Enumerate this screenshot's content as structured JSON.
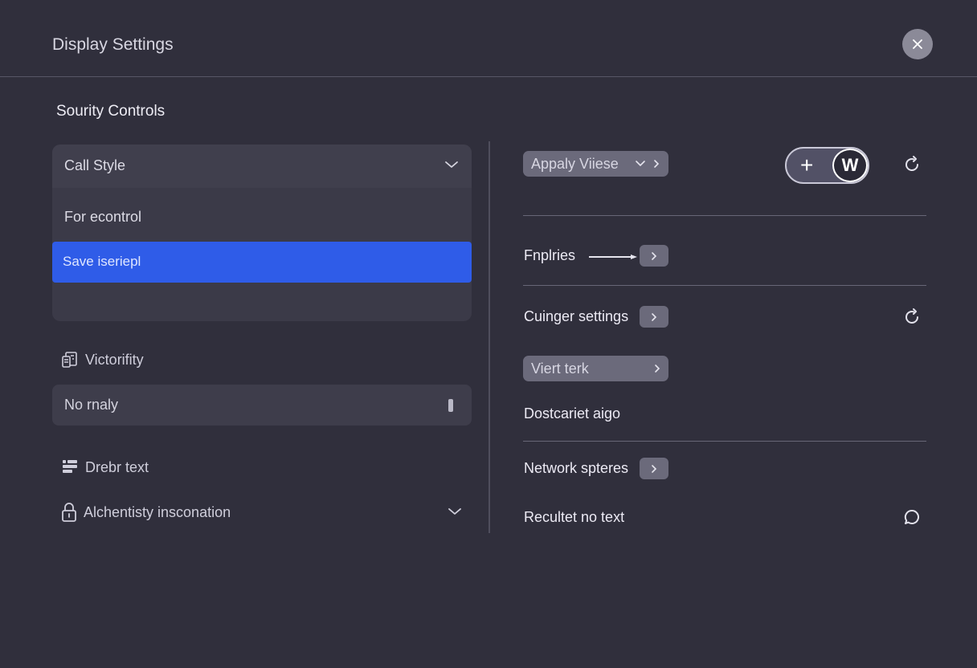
{
  "header": {
    "title": "Display Settings"
  },
  "section": {
    "title": "Sourity Controls"
  },
  "dropdown": {
    "label": "Call Style",
    "option": "For econtrol",
    "selected": "Save iseriepl"
  },
  "left": {
    "row1_label": "Victorifity",
    "field_value": "No rnaly",
    "row2_label": "Drebr text",
    "row3_label": "Alchentisty insconation"
  },
  "right": {
    "apply_pill": "Appaly Viiese",
    "toggle_knob": "W",
    "item1": "Fnplries",
    "item2": "Cuinger settings",
    "view_pill": "Viert terk",
    "item3": "Dostcariet aigo",
    "item4": "Network spteres",
    "item5": "Recultet no text"
  },
  "colors": {
    "background": "#302f3c",
    "accent": "#2f5ce8",
    "pill": "#6b6a7b"
  },
  "icons": {
    "close": "close-icon",
    "chevron": "chevron-down-icon",
    "refresh": "refresh-icon",
    "chat": "chat-bubble-icon",
    "lock": "lock-icon"
  }
}
